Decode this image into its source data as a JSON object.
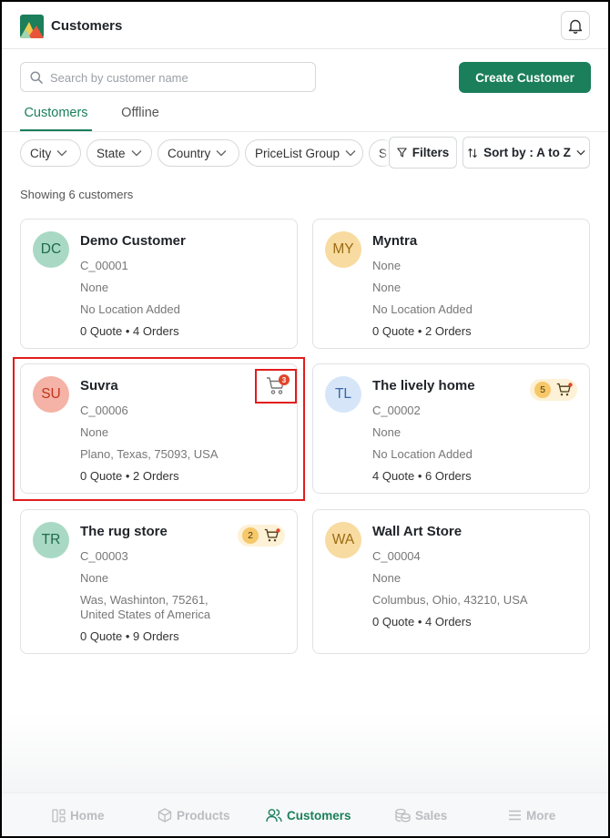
{
  "header": {
    "title": "Customers"
  },
  "search": {
    "placeholder": "Search by customer name",
    "value": ""
  },
  "create_button": "Create Customer",
  "tabs": [
    {
      "label": "Customers",
      "active": true
    },
    {
      "label": "Offline",
      "active": false
    }
  ],
  "filters": [
    {
      "label": "City"
    },
    {
      "label": "State"
    },
    {
      "label": "Country"
    },
    {
      "label": "PriceList Group"
    },
    {
      "label": "S"
    }
  ],
  "filters_button": "Filters",
  "sort_button": "Sort by : A to Z",
  "result_count_text": "Showing 6 customers",
  "customers": [
    {
      "initials": "DC",
      "name": "Demo Customer",
      "code": "C_00001",
      "field": "None",
      "location": "No Location Added",
      "stats": "0 Quote • 4 Orders",
      "cart_count": null,
      "avatar_bg": "#a9d9c4",
      "avatar_fg": "#1d6b4a"
    },
    {
      "initials": "MY",
      "name": "Myntra",
      "code": "None",
      "field": "None",
      "location": "No Location Added",
      "stats": "0 Quote • 2 Orders",
      "cart_count": null,
      "avatar_bg": "#f8dba0",
      "avatar_fg": "#9a6a12"
    },
    {
      "initials": "SU",
      "name": "Suvra",
      "code": "C_00006",
      "field": "None",
      "location": "Plano, Texas, 75093, USA",
      "stats": "0 Quote • 2 Orders",
      "cart_count": "3",
      "avatar_bg": "#f4b3a6",
      "avatar_fg": "#c2341e",
      "highlighted": true
    },
    {
      "initials": "TL",
      "name": "The lively home",
      "code": "C_00002",
      "field": "None",
      "location": "No Location Added",
      "stats": "4 Quote • 6 Orders",
      "cart_count": "5",
      "avatar_bg": "#d6e6f8",
      "avatar_fg": "#3a66a6"
    },
    {
      "initials": "TR",
      "name": "The rug store",
      "code": "C_00003",
      "field": "None",
      "location": "Was, Washinton, 75261,",
      "location2": "United States of America",
      "stats": "0 Quote • 9 Orders",
      "cart_count": "2",
      "avatar_bg": "#a9d9c4",
      "avatar_fg": "#1d6b4a"
    },
    {
      "initials": "WA",
      "name": "Wall Art Store",
      "code": "C_00004",
      "field": "None",
      "location": "Columbus, Ohio, 43210, USA",
      "stats": "0 Quote • 4 Orders",
      "cart_count": null,
      "avatar_bg": "#f8dba0",
      "avatar_fg": "#9a6a12"
    }
  ],
  "bottom_nav": [
    {
      "label": "Home",
      "icon": "home-icon",
      "active": false
    },
    {
      "label": "Products",
      "icon": "box-icon",
      "active": false
    },
    {
      "label": "Customers",
      "icon": "users-icon",
      "active": true
    },
    {
      "label": "Sales",
      "icon": "coins-icon",
      "active": false
    },
    {
      "label": "More",
      "icon": "menu-icon",
      "active": false
    }
  ],
  "colors": {
    "accent": "#1a7f5a",
    "highlight": "#e11d1d",
    "cart_badge_bg": "#fdf1d7",
    "cart_dot": "#e0462a"
  }
}
